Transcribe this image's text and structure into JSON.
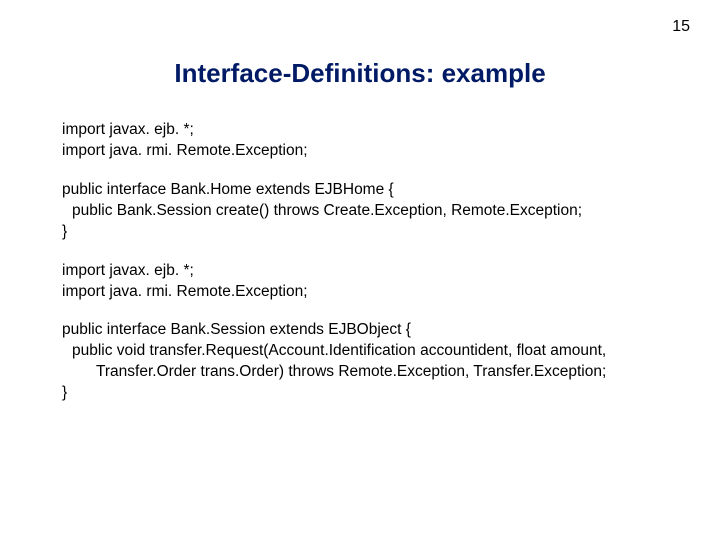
{
  "pageNumber": "15",
  "title": "Interface-Definitions: example",
  "code": {
    "l1": "import javax. ejb. *;",
    "l2": "import java. rmi. Remote.Exception;",
    "l3": "public interface Bank.Home extends EJBHome {",
    "l4": "public Bank.Session create() throws Create.Exception, Remote.Exception;",
    "l5": "}",
    "l6": "import javax. ejb. *;",
    "l7": "import java. rmi. Remote.Exception;",
    "l8": "public interface Bank.Session extends EJBObject {",
    "l9": "public void transfer.Request(Account.Identification accountident, float amount,",
    "l10": "Transfer.Order trans.Order) throws Remote.Exception, Transfer.Exception;",
    "l11": "}"
  }
}
